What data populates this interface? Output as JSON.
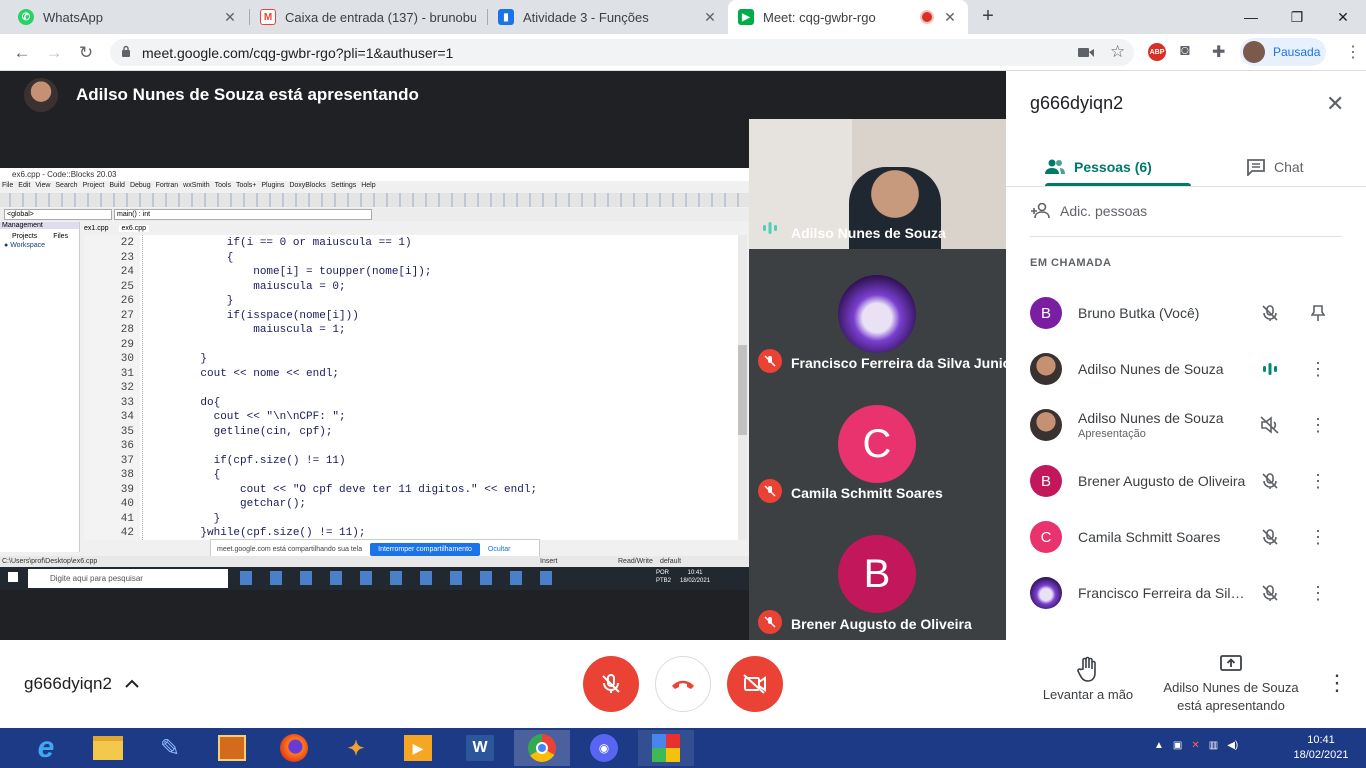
{
  "tabs": [
    {
      "title": "WhatsApp",
      "icon": "whatsapp-icon",
      "color": "#25d366"
    },
    {
      "title": "Caixa de entrada (137) - brunobu",
      "icon": "gmail-icon",
      "color": "#ea4335"
    },
    {
      "title": "Atividade 3 - Funções",
      "icon": "classroom-icon",
      "color": "#1a73e8"
    },
    {
      "title": "Meet: cqg-gwbr-rgo",
      "icon": "meet-icon",
      "color": "#00ac47"
    }
  ],
  "address": {
    "url": "meet.google.com/cqg-gwbr-rgo?pli=1&authuser=1",
    "profile_label": "Pausada"
  },
  "presenter": {
    "banner": "Adilso Nunes de Souza está apresentando"
  },
  "shared_screen": {
    "window_title": "ex6.cpp - Code::Blocks 20.03",
    "menu": [
      "File",
      "Edit",
      "View",
      "Search",
      "Project",
      "Build",
      "Debug",
      "Fortran",
      "wxSmith",
      "Tools",
      "Tools+",
      "Plugins",
      "DoxyBlocks",
      "Settings",
      "Help"
    ],
    "scope_left": "<global>",
    "scope_right": "main() : int",
    "mgmt_title": "Management",
    "mgmt_tabs": [
      "Projects",
      "Files"
    ],
    "workspace": "Workspace",
    "file_tabs": [
      "ex1.cpp",
      "ex6.cpp"
    ],
    "code": [
      {
        "n": "22",
        "t": "        if(i == 0 or maiuscula == 1)"
      },
      {
        "n": "23",
        "t": "        {"
      },
      {
        "n": "24",
        "t": "            nome[i] = toupper(nome[i]);"
      },
      {
        "n": "25",
        "t": "            maiuscula = 0;"
      },
      {
        "n": "26",
        "t": "        }"
      },
      {
        "n": "27",
        "t": "        if(isspace(nome[i]))"
      },
      {
        "n": "28",
        "t": "            maiuscula = 1;"
      },
      {
        "n": "29",
        "t": ""
      },
      {
        "n": "30",
        "t": "    }"
      },
      {
        "n": "31",
        "t": "    cout << nome << endl;"
      },
      {
        "n": "32",
        "t": ""
      },
      {
        "n": "33",
        "t": "    do{"
      },
      {
        "n": "34",
        "t": "      cout << \"\\n\\nCPF: \";"
      },
      {
        "n": "35",
        "t": "      getline(cin, cpf);"
      },
      {
        "n": "36",
        "t": ""
      },
      {
        "n": "37",
        "t": "      if(cpf.size() != 11)"
      },
      {
        "n": "38",
        "t": "      {"
      },
      {
        "n": "39",
        "t": "          cout << \"O cpf deve ter 11 digitos.\" << endl;"
      },
      {
        "n": "40",
        "t": "          getchar();"
      },
      {
        "n": "41",
        "t": "      }"
      },
      {
        "n": "42",
        "t": "    }while(cpf.size() != 11);"
      }
    ],
    "share_notice": "meet.google.com está compartilhando sua tela",
    "share_stop": "Interromper compartilhamento",
    "share_hide": "Ocultar",
    "status_path": "C:\\Users\\prof\\Desktop\\ex6.cpp",
    "status_rw": "Read/Write",
    "status_default": "default",
    "status_insert": "Insert",
    "remote_search": "Digite aqui para pesquisar",
    "remote_lang": "POR",
    "remote_kb": "PTB2",
    "remote_time": "10:41",
    "remote_date": "18/02/2021"
  },
  "tiles": [
    {
      "name": "Adilso Nunes de Souza",
      "kind": "video"
    },
    {
      "name": "Francisco Ferreira da Silva Junior",
      "kind": "image"
    },
    {
      "name": "Camila Schmitt Soares",
      "letter": "C",
      "color": "#e8336f"
    },
    {
      "name": "Brener Augusto de Oliveira",
      "letter": "B",
      "color": "#c2185b"
    }
  ],
  "panel": {
    "meeting_code": "g666dyiqn2",
    "tab_people": "Pessoas (6)",
    "tab_chat": "Chat",
    "add_people": "Adic. pessoas",
    "section": "EM CHAMADA",
    "people": [
      {
        "name": "Bruno Butka (Você)",
        "sub": "",
        "letter": "B",
        "color": "#7b1fa2"
      },
      {
        "name": "Adilso Nunes de Souza",
        "sub": "",
        "photo": true
      },
      {
        "name": "Adilso Nunes de Souza",
        "sub": "Apresentação",
        "photo": true
      },
      {
        "name": "Brener Augusto de Oliveira",
        "sub": "",
        "letter": "B",
        "color": "#c2185b"
      },
      {
        "name": "Camila Schmitt Soares",
        "sub": "",
        "letter": "C",
        "color": "#e8336f"
      },
      {
        "name": "Francisco Ferreira da Silva Junior",
        "sub": "",
        "photo": true
      }
    ]
  },
  "bottom": {
    "meeting_code": "g666dyiqn2",
    "raise_hand": "Levantar a mão",
    "presenting_line1": "Adilso Nunes de Souza",
    "presenting_line2": "está apresentando"
  },
  "taskbar": {
    "time": "10:41",
    "date": "18/02/2021"
  }
}
